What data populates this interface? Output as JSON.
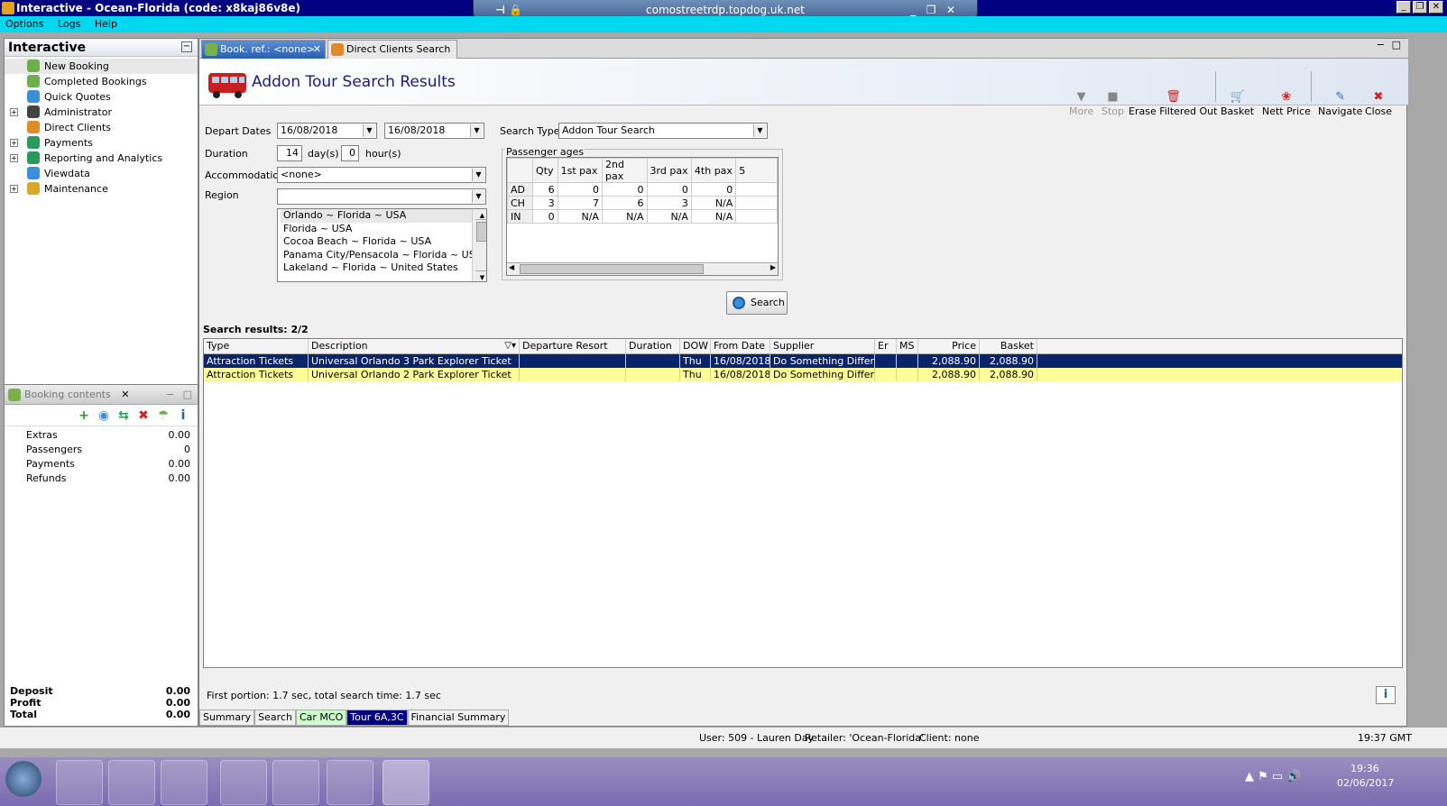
{
  "window": {
    "title": "Interactive - Ocean-Florida (code: x8kaj86v8e)",
    "rdp_host": "comostreetrdp.topdog.uk.net",
    "min": "_",
    "restore": "❐",
    "close": "✕"
  },
  "menu": [
    "Options",
    "Logs",
    "Help"
  ],
  "sidebar": {
    "title": "Interactive",
    "items": [
      {
        "label": "New Booking",
        "expandable": false,
        "selected": true,
        "color": "#6ab04c"
      },
      {
        "label": "Completed Bookings",
        "expandable": false,
        "color": "#6ab04c"
      },
      {
        "label": "Quick Quotes",
        "expandable": false,
        "color": "#3a8fd8"
      },
      {
        "label": "Administrator",
        "expandable": true,
        "color": "#444"
      },
      {
        "label": "Direct Clients",
        "expandable": false,
        "color": "#e08a2a"
      },
      {
        "label": "Payments",
        "expandable": true,
        "color": "#2a9a5a"
      },
      {
        "label": "Reporting and Analytics",
        "expandable": true,
        "color": "#2a9a5a"
      },
      {
        "label": "Viewdata",
        "expandable": false,
        "color": "#3a8fd8"
      },
      {
        "label": "Maintenance",
        "expandable": true,
        "color": "#d8a82a"
      }
    ]
  },
  "booking_panel": {
    "title": "Booking contents",
    "icons": [
      "+",
      "◉",
      "⇆",
      "✖",
      "☂",
      "i"
    ],
    "rows": [
      {
        "label": "Extras",
        "value": "0.00"
      },
      {
        "label": "Passengers",
        "value": "0"
      },
      {
        "label": "Payments",
        "value": "0.00"
      },
      {
        "label": "Refunds",
        "value": "0.00"
      }
    ],
    "totals": [
      {
        "label": "Deposit",
        "value": "0.00"
      },
      {
        "label": "Profit",
        "value": "0.00"
      },
      {
        "label": "Total",
        "value": "0.00"
      }
    ]
  },
  "tabs": [
    {
      "label": "Book. ref.: <none>",
      "active": true
    },
    {
      "label": "Direct Clients Search",
      "active": false
    }
  ],
  "header": {
    "title": "Addon Tour Search Results"
  },
  "toolbar": [
    {
      "label": "More",
      "icon": "▼",
      "enabled": false
    },
    {
      "label": "Stop",
      "icon": "■",
      "enabled": false
    },
    {
      "label": "Erase Filtered Out",
      "icon": "🗑",
      "enabled": true
    },
    {
      "label": "Basket",
      "icon": "🛒",
      "enabled": true
    },
    {
      "label": "Nett Price",
      "icon": "❀",
      "enabled": true
    },
    {
      "label": "Navigate",
      "icon": "✎",
      "enabled": true
    },
    {
      "label": "Close",
      "icon": "✖",
      "enabled": true
    }
  ],
  "form": {
    "depart_label": "Depart Dates",
    "depart_from": "16/08/2018",
    "depart_to": "16/08/2018",
    "duration_label": "Duration",
    "days": "14",
    "days_unit": "day(s)",
    "hours": "0",
    "hours_unit": "hour(s)",
    "accommodation_label": "Accommodation",
    "accommodation": "<none>",
    "region_label": "Region",
    "region": "",
    "regions": [
      "Orlando ~ Florida ~ USA",
      "Florida ~ USA",
      "Cocoa Beach ~ Florida ~ USA",
      "Panama City/Pensacola ~  Florida  ~ USA",
      "Lakeland ~ Florida ~ United States"
    ],
    "search_type_label": "Search Type",
    "search_type": "Addon Tour Search",
    "pax_label": "Passenger ages",
    "pax_headers": [
      "",
      "Qty",
      "1st pax",
      "2nd pax",
      "3rd pax",
      "4th pax",
      "5"
    ],
    "pax_rows": [
      [
        "AD",
        "6",
        "0",
        "0",
        "0",
        "0"
      ],
      [
        "CH",
        "3",
        "7",
        "6",
        "3",
        "N/A"
      ],
      [
        "IN",
        "0",
        "N/A",
        "N/A",
        "N/A",
        "N/A"
      ]
    ],
    "search_button": "Search"
  },
  "results": {
    "count_label": "Search results: 2/2",
    "columns": [
      "Type",
      "Description",
      "Departure Resort",
      "Duration",
      "DOW",
      "From Date",
      "Supplier",
      "Er",
      "MS",
      "Price",
      "Basket"
    ],
    "rows": [
      [
        "Attraction Tickets",
        "Universal Orlando 3 Park Explorer Ticket",
        "",
        "",
        "Thu",
        "16/08/2018",
        "Do Something Different",
        "",
        "",
        "2,088.90",
        "2,088.90"
      ],
      [
        "Attraction Tickets",
        "Universal Orlando 2 Park Explorer Ticket",
        "",
        "",
        "Thu",
        "16/08/2018",
        "Do Something Different",
        "",
        "",
        "2,088.90",
        "2,088.90"
      ]
    ]
  },
  "timing": "First portion: 1.7 sec, total search time: 1.7 sec",
  "bottom_tabs": [
    {
      "label": "Summary",
      "bg": "#f0f0f0",
      "fg": "#000"
    },
    {
      "label": "Search",
      "bg": "#f0f0f0",
      "fg": "#000"
    },
    {
      "label": "Car MCO",
      "bg": "#ccffcc",
      "fg": "#000"
    },
    {
      "label": "Tour 6A,3C",
      "bg": "#000080",
      "fg": "#fff"
    },
    {
      "label": "Financial Summary",
      "bg": "#f0f0f0",
      "fg": "#000"
    }
  ],
  "status": {
    "user": "User: 509 - Lauren Day",
    "retailer": "Retailer: 'Ocean-Florida'",
    "client": "Client: none",
    "time": "19:37 GMT"
  },
  "taskbar": {
    "clock_time": "19:36",
    "clock_date": "02/06/2017"
  }
}
